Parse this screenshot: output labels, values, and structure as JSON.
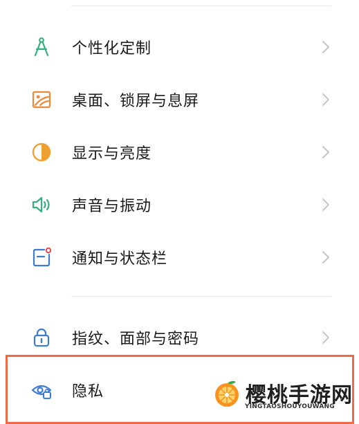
{
  "settings": {
    "items": [
      {
        "label": "个性化定制",
        "icon": "compass-icon"
      },
      {
        "label": "桌面、锁屏与息屏",
        "icon": "wallpaper-icon"
      },
      {
        "label": "显示与亮度",
        "icon": "brightness-icon"
      },
      {
        "label": "声音与振动",
        "icon": "speaker-icon"
      },
      {
        "label": "通知与状态栏",
        "icon": "notification-icon"
      },
      {
        "label": "指纹、面部与密码",
        "icon": "lock-icon"
      },
      {
        "label": "隐私",
        "icon": "privacy-eye-icon"
      }
    ]
  },
  "watermark": {
    "title": "樱桃手游网",
    "subtitle": "YINGTAOSHOUYOUWANG"
  },
  "colors": {
    "highlight_border": "#ee6b45",
    "icon_green": "#33b07a",
    "icon_orange": "#f0883a",
    "icon_blue": "#3a7bd5"
  }
}
